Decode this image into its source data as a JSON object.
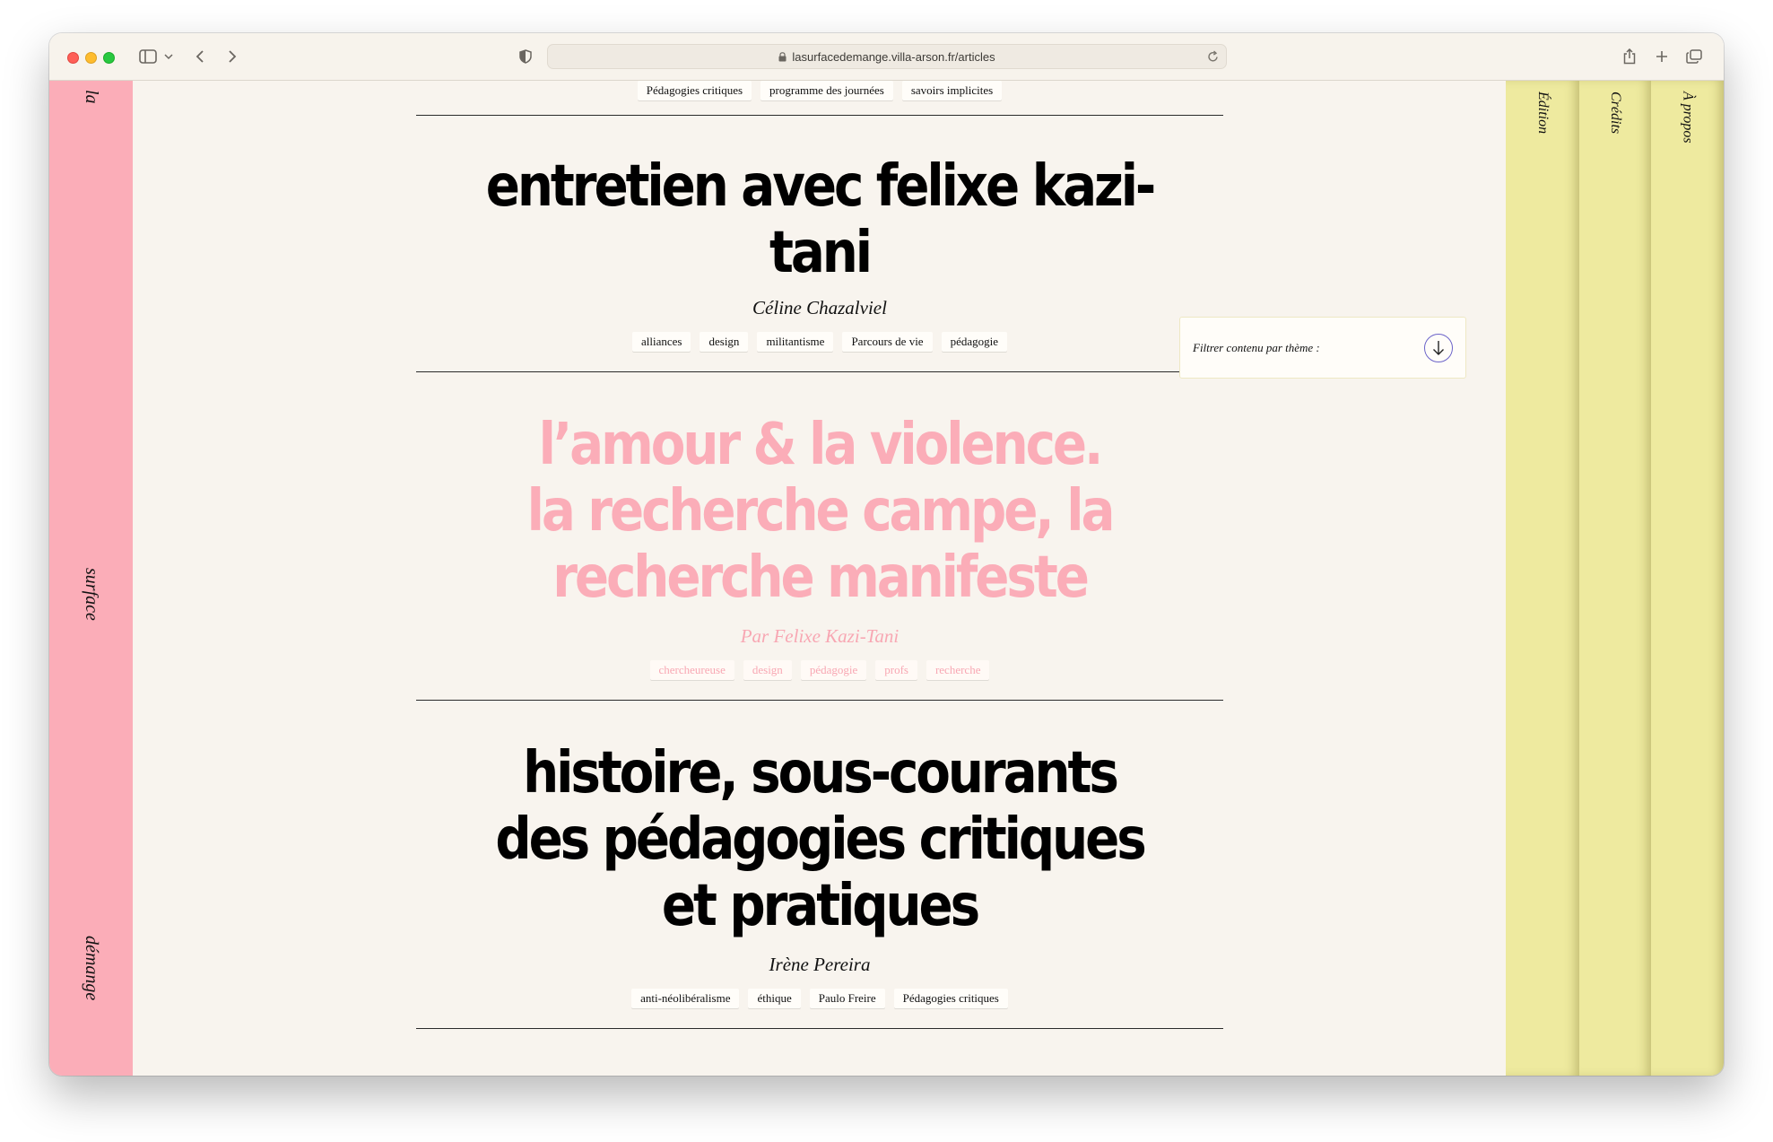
{
  "browser": {
    "url": "lasurfacedemange.villa-arson.fr/articles"
  },
  "sidebar_left": {
    "words": [
      "la",
      "surface",
      "démange"
    ]
  },
  "sidebar_right": {
    "tabs": [
      "Édition",
      "Crédits",
      "À propos"
    ]
  },
  "filter": {
    "label": "Filtrer contenu par thème :"
  },
  "top_tags": [
    "Pédagogies critiques",
    "programme des journées",
    "savoirs implicites"
  ],
  "articles": [
    {
      "title": "entretien avec felixe kazi-tani",
      "author": "Céline Chazalviel",
      "tags": [
        "alliances",
        "design",
        "militantisme",
        "Parcours de vie",
        "pédagogie"
      ]
    },
    {
      "title": "l’amour & la violence. la recherche campe, la recherche manifeste",
      "author": "Par Felixe Kazi-Tani",
      "tags": [
        "chercheureuse",
        "design",
        "pédagogie",
        "profs",
        "recherche"
      ]
    },
    {
      "title": "histoire, sous-courants des pédagogies critiques et pratiques",
      "author": "Irène Pereira",
      "tags": [
        "anti-néolibéralisme",
        "éthique",
        "Paulo Freire",
        "Pédagogies critiques"
      ]
    }
  ],
  "colors": {
    "pink": "#fbadb8",
    "yellow": "#eeea9f",
    "background": "#f8f4ee"
  }
}
